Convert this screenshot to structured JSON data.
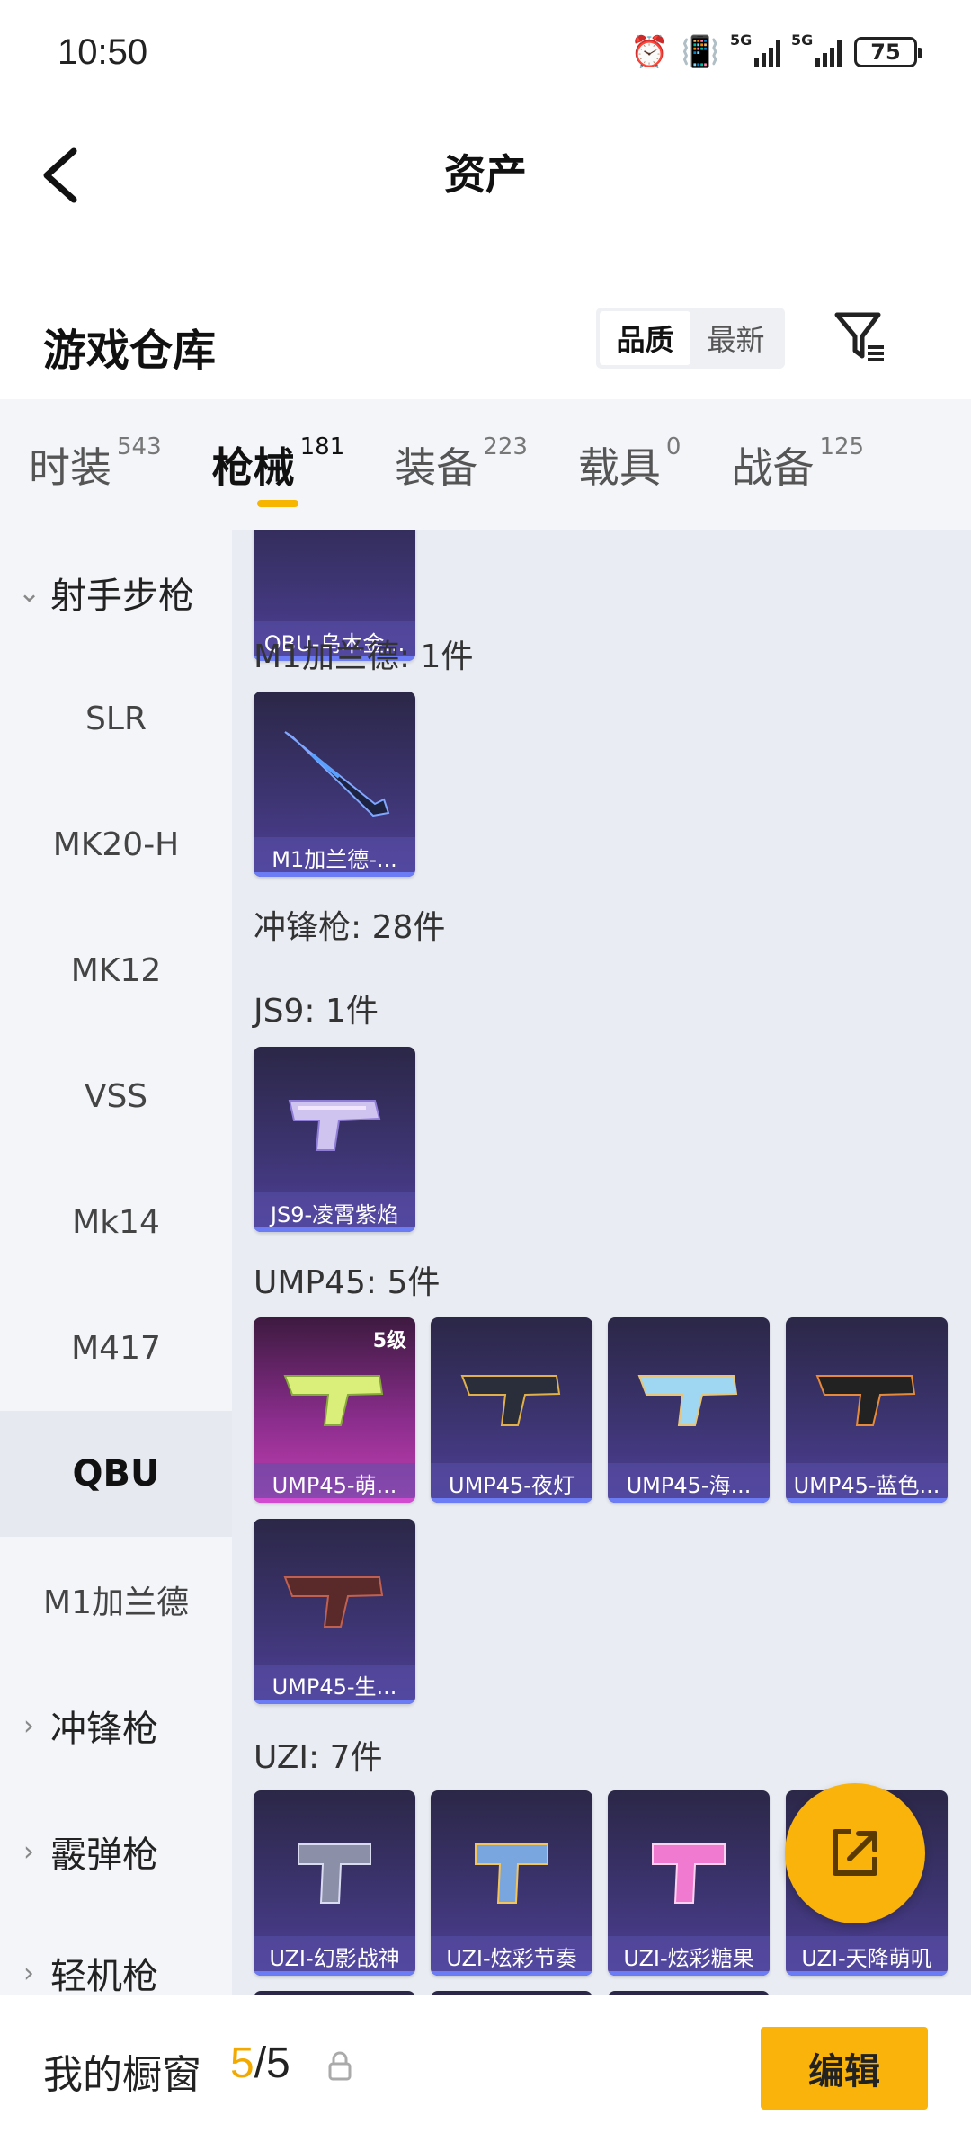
{
  "status_bar": {
    "time": "10:50",
    "network_1": "5G",
    "network_2": "5G",
    "battery": "75"
  },
  "header": {
    "title": "资产"
  },
  "section": {
    "title": "游戏仓库",
    "sort_options": [
      "品质",
      "最新"
    ],
    "active_sort": "品质"
  },
  "tabs": [
    {
      "label": "时装",
      "count": "543"
    },
    {
      "label": "枪械",
      "count": "181",
      "active": true
    },
    {
      "label": "装备",
      "count": "223"
    },
    {
      "label": "载具",
      "count": "0"
    },
    {
      "label": "战备",
      "count": "125"
    }
  ],
  "sidebar": {
    "group_rifle": "射手步枪",
    "items": [
      "SLR",
      "MK20-H",
      "MK12",
      "VSS",
      "Mk14",
      "M417",
      "QBU",
      "M1加兰德"
    ],
    "active_item": "QBU",
    "group_smg": "冲锋枪",
    "group_shotgun": "霰弹枪",
    "group_lmg": "轻机枪"
  },
  "content": {
    "partial_card": "QBU-乌木金...",
    "m1_label": "M1加兰德: 1件",
    "m1_card": "M1加兰德-...",
    "smg_label": "冲锋枪: 28件",
    "js9_label": "JS9: 1件",
    "js9_card": "JS9-凌霄紫焰",
    "ump_label": "UMP45: 5件",
    "ump_cards": [
      "UMP45-萌...",
      "UMP45-夜灯",
      "UMP45-海...",
      "UMP45-蓝色...",
      "UMP45-生..."
    ],
    "ump_level": "5级",
    "uzi_label": "UZI: 7件",
    "uzi_cards": [
      "UZI-幻影战神",
      "UZI-炫彩节奏",
      "UZI-炫彩糖果",
      "UZI-天降萌叽"
    ]
  },
  "bottom": {
    "label": "我的橱窗",
    "current": "5",
    "total": "/5",
    "edit": "编辑"
  },
  "colors": {
    "accent": "#f9b30a",
    "card_purple": "#3c3470",
    "card_pink": "#c43fb4"
  },
  "icons": [
    "back-icon",
    "alarm-icon",
    "vibrate-icon",
    "filter-icon",
    "lock-icon",
    "share-icon",
    "chevron-down-icon",
    "chevron-right-icon"
  ]
}
